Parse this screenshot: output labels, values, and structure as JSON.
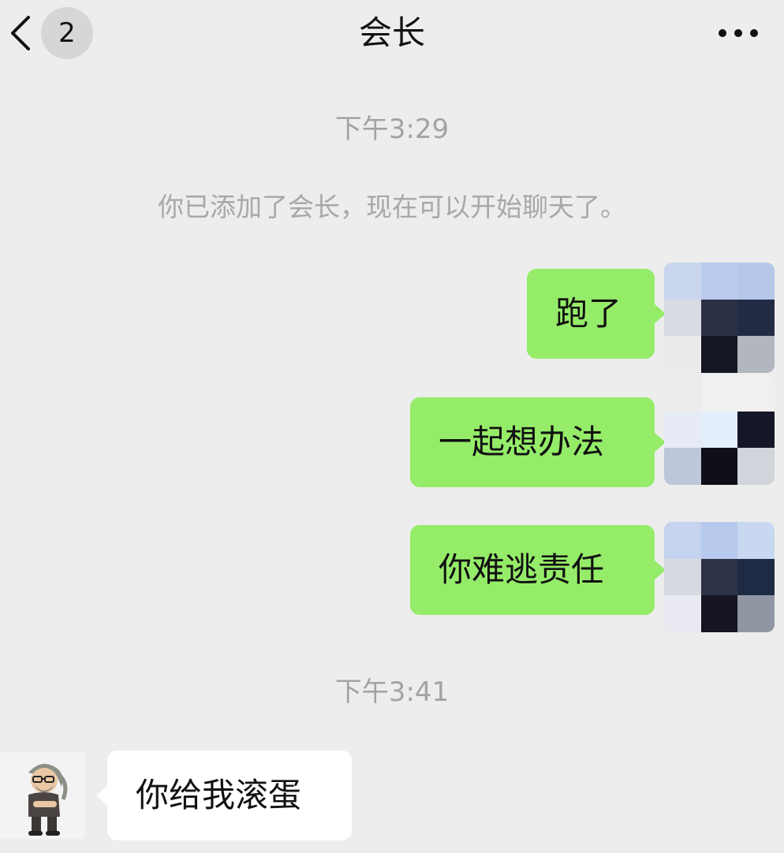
{
  "header": {
    "title": "会长",
    "unread_count": "2",
    "back_icon": "chevron-left-icon",
    "more_icon": "more-dots-icon"
  },
  "messages": {
    "timestamp_1": "下午3:29",
    "system_notice": "你已添加了会长，现在可以开始聊天了。",
    "outgoing": [
      {
        "text": "跑了"
      },
      {
        "text": "一起想办法"
      },
      {
        "text": "你难逃责任"
      }
    ],
    "timestamp_2": "下午3:41",
    "incoming": [
      {
        "text": "你给我滚蛋"
      }
    ]
  },
  "colors": {
    "background": "#ededed",
    "outgoing_bubble": "#95ec69",
    "incoming_bubble": "#ffffff",
    "timestamp_text": "#a3a3a3"
  }
}
